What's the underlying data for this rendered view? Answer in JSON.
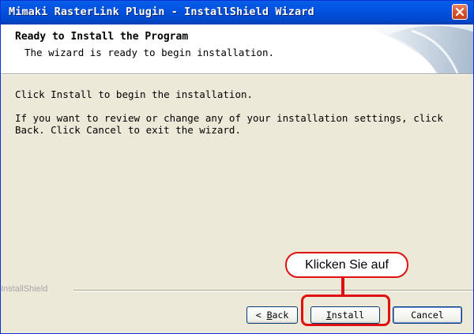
{
  "window": {
    "title": "Mimaki RasterLink Plugin - InstallShield Wizard"
  },
  "header": {
    "title": "Ready to Install the Program",
    "subtitle": "The wizard is ready to begin installation."
  },
  "body": {
    "line1": "Click Install to begin the installation.",
    "line2": "If you want to review or change any of your installation settings, click",
    "line3": "Back. Click Cancel to exit the wizard."
  },
  "footer": {
    "brand": "InstallShield"
  },
  "buttons": {
    "back_prefix": "< ",
    "back_accel": "B",
    "back_rest": "ack",
    "install_accel": "I",
    "install_rest": "nstall",
    "cancel": "Cancel"
  },
  "annotation": {
    "callout": "Klicken Sie auf",
    "color": "#e01010"
  },
  "icons": {
    "close": "close-icon",
    "header": "wizard-header-graphic"
  }
}
